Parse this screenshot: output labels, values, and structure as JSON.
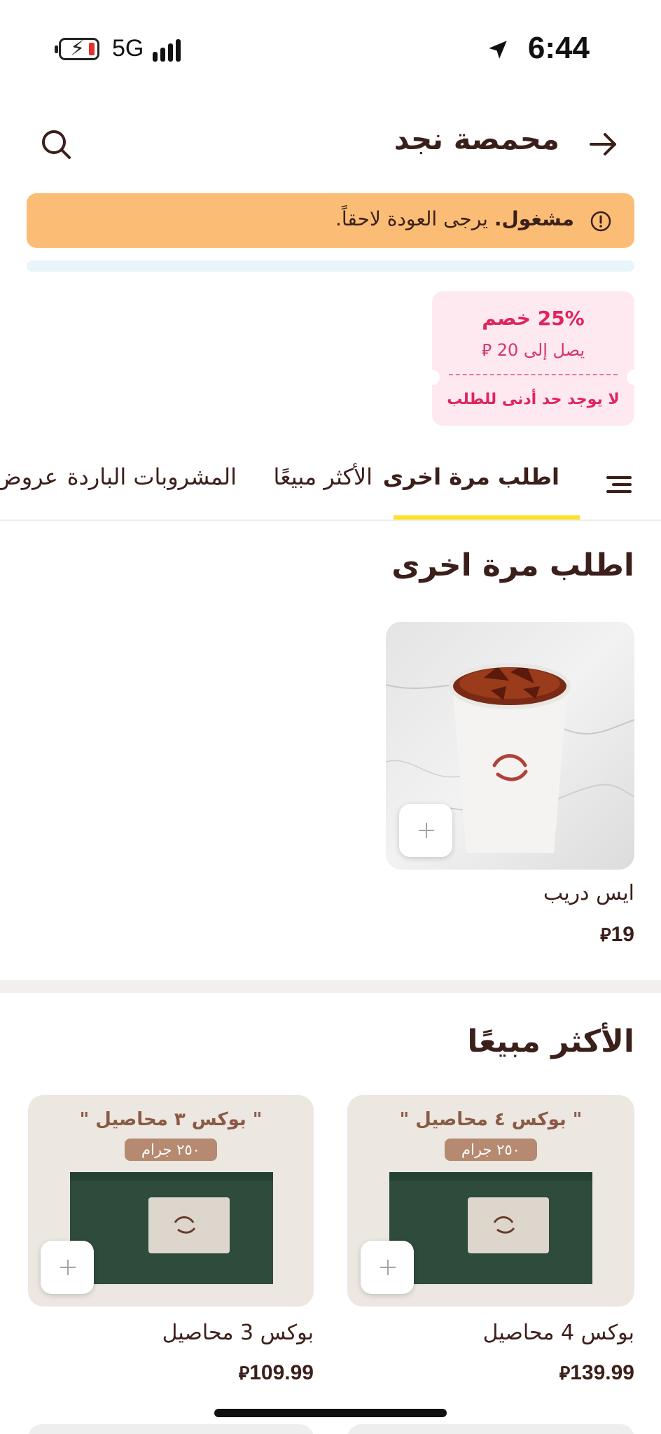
{
  "status_bar": {
    "network": "5G",
    "time": "6:44"
  },
  "header": {
    "title": "محمصة نجد"
  },
  "busy_banner": {
    "status": "مشغول.",
    "message": "يرجى العودة لاحقاً."
  },
  "coupon": {
    "title": "25% خصم",
    "subtitle": "يصل إلى 20 ⃁",
    "minimum": "لا يوجد حد أدنى للطلب"
  },
  "tabs": [
    {
      "label": "اطلب مرة اخرى",
      "active": true
    },
    {
      "label": "الأكثر مبيعًا",
      "active": false
    },
    {
      "label": "المشروبات  الباردة",
      "active": false
    },
    {
      "label": "عروض",
      "active": false
    }
  ],
  "order_again": {
    "title": "اطلب مرة اخرى",
    "items": [
      {
        "name": "ايس دريب",
        "price": "19",
        "currency": "⃁"
      }
    ]
  },
  "best_sellers": {
    "title": "الأكثر مبيعًا",
    "items": [
      {
        "name": "بوكس 4 محاصيل",
        "price": "139.99",
        "currency": "⃁",
        "image_heading": "\" بوكس ٤ محاصيل \"",
        "image_badge": "٢٥٠ جرام"
      },
      {
        "name": "بوكس 3 محاصيل",
        "price": "109.99",
        "currency": "⃁",
        "image_heading": "\" بوكس ٣ محاصيل \"",
        "image_badge": "٢٥٠ جرام"
      }
    ]
  },
  "colors": {
    "accent": "#ffe12a",
    "banner": "#fbbd75",
    "coupon_bg": "#fde9ef",
    "coupon_text": "#e0245e",
    "brand_text": "#3b1f1a"
  }
}
